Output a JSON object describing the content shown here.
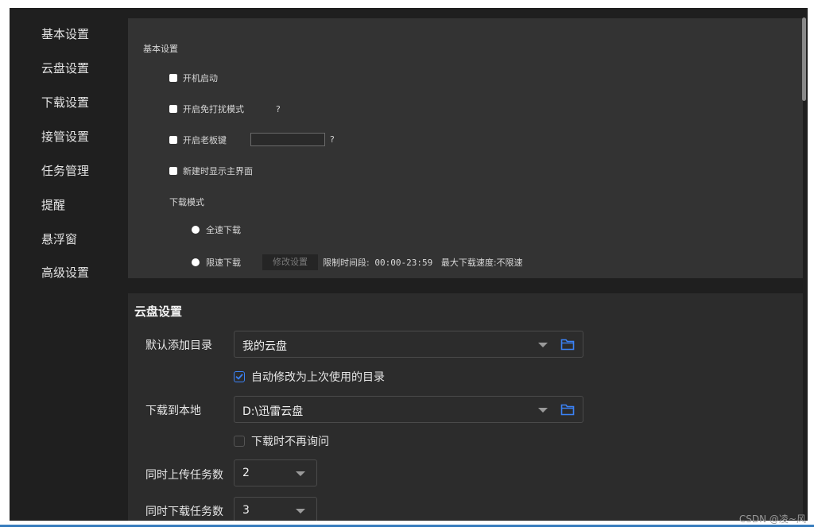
{
  "sidebar": {
    "items": [
      {
        "label": "基本设置"
      },
      {
        "label": "云盘设置"
      },
      {
        "label": "下载设置"
      },
      {
        "label": "接管设置"
      },
      {
        "label": "任务管理"
      },
      {
        "label": "提醒"
      },
      {
        "label": "悬浮窗"
      },
      {
        "label": "高级设置"
      }
    ]
  },
  "basic": {
    "title": "基本设置",
    "startup_label": "开机启动",
    "dnd_label": "开启免打扰模式",
    "dnd_help": "?",
    "bosskey_label": "开启老板键",
    "bosskey_value": "",
    "bosskey_help": "?",
    "show_main_label": "新建时显示主界面",
    "download_mode_label": "下载模式",
    "fullspeed_label": "全速下载",
    "limited_label": "限速下载",
    "modify_button": "修改设置",
    "limit_time_label": "限制时间段:",
    "limit_time_value": "00:00-23:59",
    "max_speed_label": "最大下载速度:",
    "max_speed_value": "不限速"
  },
  "cloud": {
    "title": "云盘设置",
    "default_dir_label": "默认添加目录",
    "default_dir_value": "我的云盘",
    "auto_modify_label": "自动修改为上次使用的目录",
    "auto_modify_checked": true,
    "download_local_label": "下载到本地",
    "download_local_value": "D:\\迅雷云盘",
    "no_ask_label": "下载时不再询问",
    "no_ask_checked": false,
    "upload_tasks_label": "同时上传任务数",
    "upload_tasks_value": "2",
    "download_tasks_label": "同时下载任务数",
    "download_tasks_value": "3"
  },
  "colors": {
    "accent": "#3b82f6",
    "background": "#1f1f1f",
    "panel": "#2c2c2c"
  },
  "icons": [
    "folder-icon",
    "chevron-down-icon",
    "check-icon",
    "radio-icon"
  ],
  "watermark": "CSDN @凌~风"
}
